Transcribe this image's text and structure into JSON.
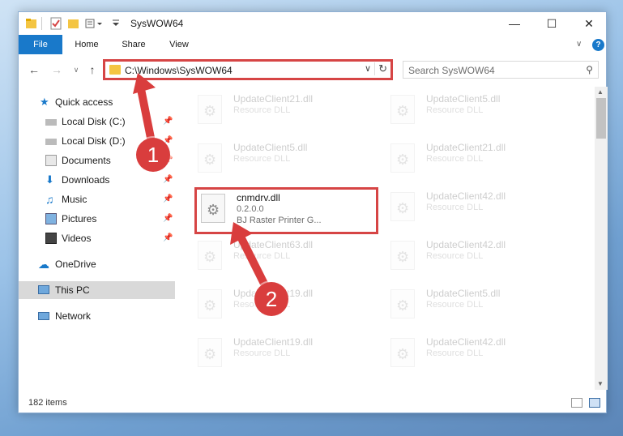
{
  "window": {
    "title": "SysWOW64"
  },
  "ribbon": {
    "tabs": [
      "File",
      "Home",
      "Share",
      "View"
    ]
  },
  "address": {
    "path": "C:\\Windows\\SysWOW64"
  },
  "search": {
    "placeholder": "Search SysWOW64"
  },
  "sidebar": {
    "items": [
      {
        "label": "Quick access",
        "icon": "star-icon"
      },
      {
        "label": "Local Disk (C:)",
        "icon": "drive-icon"
      },
      {
        "label": "Local Disk (D:)",
        "icon": "drive-icon"
      },
      {
        "label": "Documents",
        "icon": "documents-icon"
      },
      {
        "label": "Downloads",
        "icon": "download-icon"
      },
      {
        "label": "Music",
        "icon": "music-icon"
      },
      {
        "label": "Pictures",
        "icon": "pictures-icon"
      },
      {
        "label": "Videos",
        "icon": "videos-icon"
      },
      {
        "label": "OneDrive",
        "icon": "cloud-icon"
      },
      {
        "label": "This PC",
        "icon": "computer-icon"
      },
      {
        "label": "Network",
        "icon": "network-icon"
      }
    ]
  },
  "files": [
    {
      "name": "UpdateClient21.dll",
      "desc": "Resource DLL"
    },
    {
      "name": "UpdateClient5.dll",
      "desc": "Resource DLL"
    },
    {
      "name": "UpdateClient5.dll",
      "desc": "Resource DLL"
    },
    {
      "name": "UpdateClient21.dll",
      "desc": "Resource DLL"
    },
    {
      "name": "cnmdrv.dll",
      "desc": "0.2.0.0",
      "desc2": "BJ Raster Printer G..."
    },
    {
      "name": "UpdateClient42.dll",
      "desc": "Resource DLL"
    },
    {
      "name": "UpdateClient63.dll",
      "desc": "Resource DLL"
    },
    {
      "name": "UpdateClient42.dll",
      "desc": "Resource DLL"
    },
    {
      "name": "UpdateClient19.dll",
      "desc": "Resource DLL"
    },
    {
      "name": "UpdateClient5.dll",
      "desc": "Resource DLL"
    },
    {
      "name": "UpdateClient19.dll",
      "desc": "Resource DLL"
    },
    {
      "name": "UpdateClient42.dll",
      "desc": "Resource DLL"
    }
  ],
  "status": {
    "count": "182 items"
  },
  "callouts": {
    "one": "1",
    "two": "2"
  },
  "colors": {
    "accent": "#1979ca",
    "callout": "#d93d3d"
  }
}
